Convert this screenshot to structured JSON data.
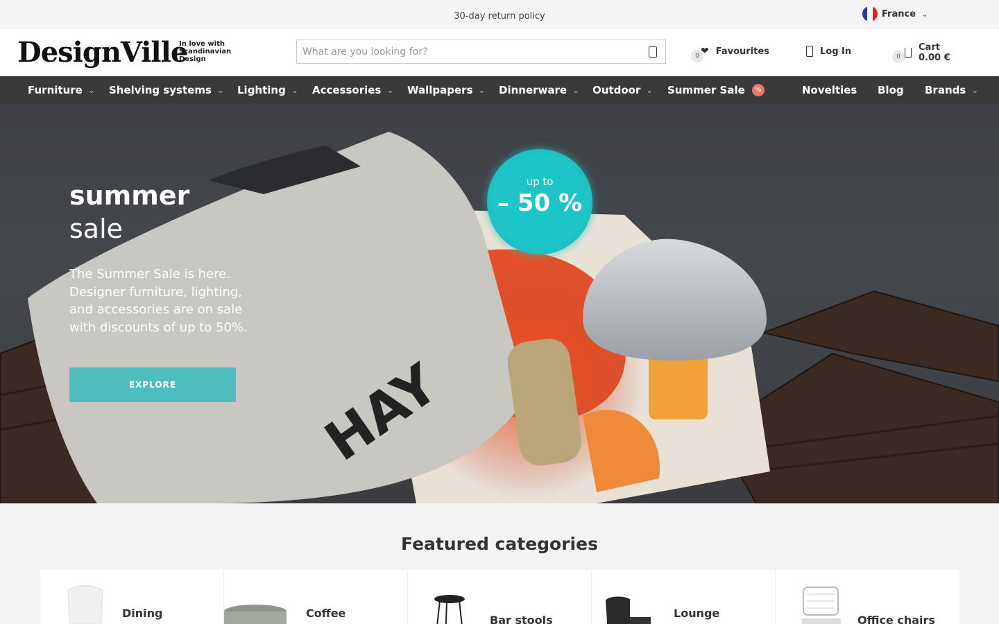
{
  "topbar": {
    "policy": "30-day return policy",
    "language": "France",
    "flag_icon": "france-flag-icon"
  },
  "header": {
    "logo": "DesignVille",
    "tagline": "In love with Scandinavian Design",
    "search": {
      "placeholder": "What are you looking for?",
      "value": ""
    },
    "favourites": {
      "label": "Favourites",
      "count": "0"
    },
    "login": {
      "label": "Log In"
    },
    "cart": {
      "label": "Cart",
      "total": "0.00 €",
      "count": "0"
    }
  },
  "nav": {
    "items": [
      {
        "label": "Furniture",
        "has_dropdown": true
      },
      {
        "label": "Shelving systems",
        "has_dropdown": true
      },
      {
        "label": "Lighting",
        "has_dropdown": true
      },
      {
        "label": "Accessories",
        "has_dropdown": true
      },
      {
        "label": "Wallpapers",
        "has_dropdown": true
      },
      {
        "label": "Dinnerware",
        "has_dropdown": true
      },
      {
        "label": "Outdoor",
        "has_dropdown": true
      },
      {
        "label": "Summer Sale",
        "badge": "%"
      },
      {
        "label": "Novelties"
      },
      {
        "label": "Blog"
      },
      {
        "label": "Brands",
        "has_dropdown": true
      }
    ]
  },
  "hero": {
    "title_bold": "summer",
    "title_light": "sale",
    "text": "The Summer Sale is here. Designer furniture, lighting, and accessories are on sale with discounts of up to 50%.",
    "cta": "EXPLORE",
    "badge_top": "up to",
    "badge_amount": "– 50 %",
    "bag_print": "HAY"
  },
  "featured": {
    "title": "Featured categories",
    "categories": [
      {
        "name": "Dining",
        "icon": "dining-chair-icon"
      },
      {
        "name": "Coffee",
        "icon": "coffee-table-icon"
      },
      {
        "name": "Bar stools",
        "icon": "bar-stool-icon"
      },
      {
        "name": "Lounge",
        "icon": "lounge-chair-icon"
      },
      {
        "name": "Office chairs",
        "icon": "office-chair-icon"
      }
    ]
  },
  "colors": {
    "accent": "#4dbdbd",
    "nav_bg": "#3a3a3a",
    "sale_badge": "#e8776e",
    "promo_circle": "#1ec5c8"
  }
}
